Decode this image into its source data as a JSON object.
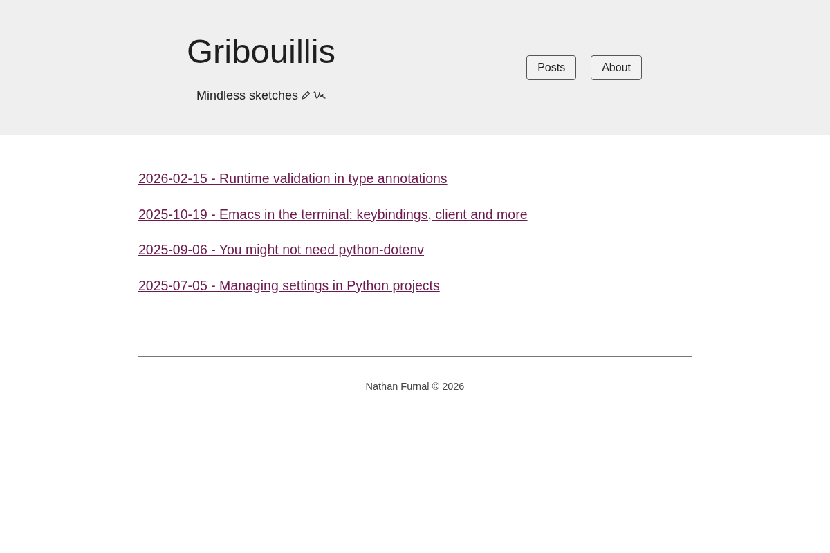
{
  "site": {
    "title": "Gribouillis",
    "tagline": "Mindless sketches"
  },
  "nav": [
    {
      "label": "Posts"
    },
    {
      "label": "About"
    }
  ],
  "posts": [
    {
      "text": "2026-02-15 - Runtime validation in type annotations"
    },
    {
      "text": "2025-10-19 - Emacs in the terminal: keybindings, client and more"
    },
    {
      "text": "2025-09-06 - You might not need python-dotenv"
    },
    {
      "text": "2025-07-05 - Managing settings in Python projects"
    }
  ],
  "footer": {
    "text": "Nathan Furnal © 2026"
  }
}
